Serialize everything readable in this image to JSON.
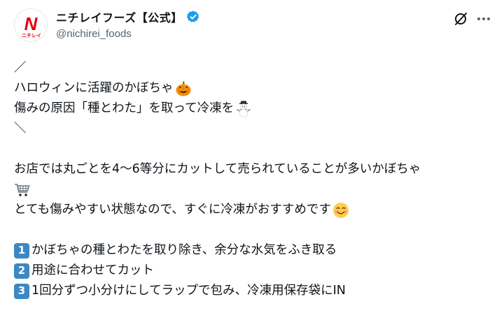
{
  "author": {
    "display_name": "ニチレイフーズ【公式】",
    "handle": "@nichirei_foods",
    "avatar_text": "ニチレイ",
    "avatar_mark": "N"
  },
  "icons": {
    "verified": "verified-badge-icon",
    "grok": "grok-icon",
    "more": "more-options-icon",
    "pumpkin": "jack-o-lantern-emoji",
    "snowman": "snowman-emoji",
    "cart": "shopping-cart-emoji",
    "smile": "smiling-face-emoji"
  },
  "colors": {
    "brand_red": "#e60012",
    "verified_blue": "#1d9bf0",
    "keycap_blue": "#3b88c3"
  },
  "tweet": {
    "line1": "／",
    "line2": "ハロウィンに活躍のかぼちゃ",
    "line3": "傷みの原因「種とわた」を取って冷凍を",
    "line4": "＼",
    "line5": "お店では丸ごとを4～6等分にカットして売られていることが多いかぼちゃ",
    "line6": "とても傷みやすい状態なので、すぐに冷凍がおすすめです",
    "steps": [
      {
        "num": "1",
        "text": "かぼちゃの種とわたを取り除き、余分な水気をふき取る"
      },
      {
        "num": "2",
        "text": "用途に合わせてカット"
      },
      {
        "num": "3",
        "text": "1回分ずつ小分けにしてラップで包み、冷凍用保存袋にIN"
      }
    ]
  }
}
